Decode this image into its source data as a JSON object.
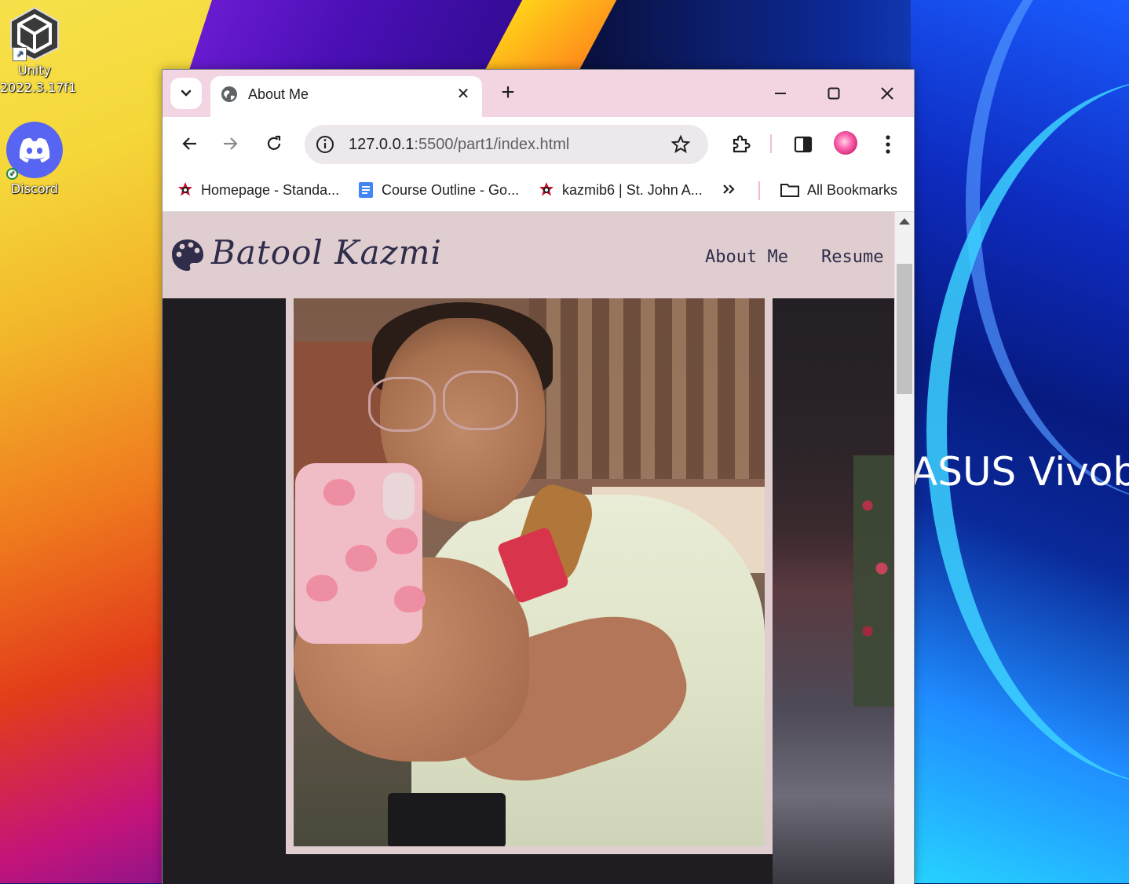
{
  "desktop": {
    "icons": [
      {
        "label_line1": "Unity",
        "label_line2": "2022.3.17f1",
        "icon": "unity-icon"
      },
      {
        "label_line1": "Discord",
        "icon": "discord-icon"
      }
    ],
    "wallpaper_text": "ASUS Vivobo"
  },
  "browser": {
    "tab": {
      "title": "About Me",
      "favicon": "globe-icon"
    },
    "window_controls": [
      "minimize-icon",
      "maximize-icon",
      "close-icon"
    ],
    "toolbar": {
      "url_host": "127.0.0.1",
      "url_rest": ":5500/part1/index.html"
    },
    "bookmarks": [
      {
        "label": "Homepage - Standa...",
        "icon": "sjac-crest-icon"
      },
      {
        "label": "Course Outline - Go...",
        "icon": "google-docs-icon"
      },
      {
        "label": "kazmib6 | St. John A...",
        "icon": "sjac-crest-icon"
      }
    ],
    "all_bookmarks_label": "All Bookmarks"
  },
  "page": {
    "brand": "Batool Kazmi",
    "nav": [
      {
        "label": "About Me"
      },
      {
        "label": "Resume"
      }
    ]
  },
  "colors": {
    "tab_strip": "#f3d4e2",
    "site_nav_bg": "#dfcdd0",
    "site_text": "#2f2d4a",
    "page_bg": "#1f1c22"
  }
}
